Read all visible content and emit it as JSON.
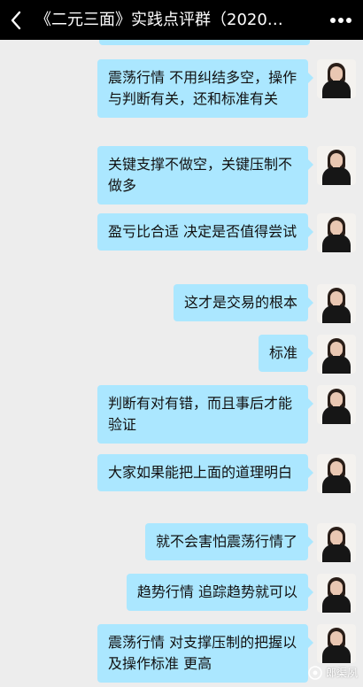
{
  "header": {
    "title": "《二元三面》实践点评群（2020…",
    "back_icon": "back-chevron-icon",
    "more_icon": "more-dots-icon"
  },
  "messages": [
    {
      "text": "震荡行情 不用纠结多空，操作与判断有关，还和标准有关"
    },
    {
      "text": "关键支撑不做空，关键压制不做多"
    },
    {
      "text": "盈亏比合适 决定是否值得尝试"
    },
    {
      "text": "这才是交易的根本"
    },
    {
      "text": "标准"
    },
    {
      "text": "判断有对有错，而且事后才能验证"
    },
    {
      "text": "大家如果能把上面的道理明白"
    },
    {
      "text": "就不会害怕震荡行情了"
    },
    {
      "text": "趋势行情 追踪趋势就可以"
    },
    {
      "text": "震荡行情 对支撑压制的把握以及操作标准 更高"
    }
  ],
  "watermark": {
    "text": "郎渠夙",
    "icon": "wechat-channel-icon"
  }
}
